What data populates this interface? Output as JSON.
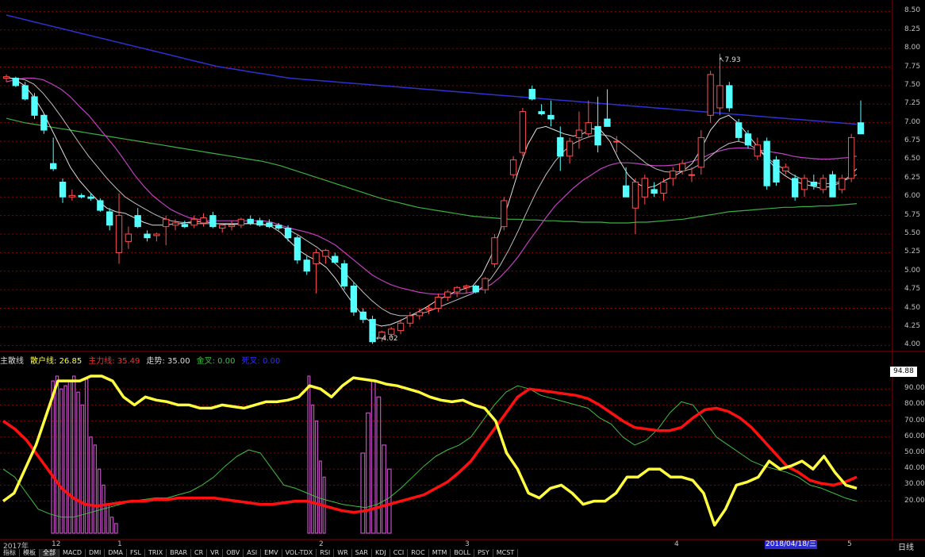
{
  "colors": {
    "grid": "#8b0000",
    "up_candle": "#ff5050",
    "down_candle": "#54ffff",
    "ma_white": "#e0e0e0",
    "ma_purple": "#c040c0",
    "ma_green": "#3cb043",
    "ma_blue": "#3030d0",
    "yellow": "#ffff40",
    "red": "#ff1010",
    "green_thin": "#40c040",
    "bars": "#c050c0"
  },
  "price_axis": {
    "ticks": [
      "8.50",
      "8.25",
      "8.00",
      "7.75",
      "7.50",
      "7.25",
      "7.00",
      "6.75",
      "6.50",
      "6.25",
      "6.00",
      "5.75",
      "5.50",
      "5.25",
      "5.00",
      "4.75",
      "4.50",
      "4.25",
      "4.00"
    ]
  },
  "annotations": {
    "high": "7.93",
    "low": "4.02"
  },
  "indicator": {
    "name": "主散线",
    "retail_label": "散户线:",
    "retail_value": "26.85",
    "main_label": "主力线:",
    "main_value": "35.49",
    "trend_label": "走势:",
    "trend_value": "35.00",
    "gold_label": "金叉:",
    "gold_value": "0.00",
    "dead_label": "死叉:",
    "dead_value": "0.00",
    "current_badge": "94.88",
    "axis_ticks": [
      "90.00",
      "80.00",
      "70.00",
      "60.00",
      "50.00",
      "40.00",
      "30.00",
      "20.00"
    ]
  },
  "x_axis": {
    "year_label": "2017年",
    "months": [
      "12",
      "1",
      "2",
      "3",
      "4",
      "5"
    ],
    "date_badge": "2018/04/18/三",
    "period": "日线"
  },
  "tabs": [
    "指标",
    "模板",
    "全部",
    "MACD",
    "DMI",
    "DMA",
    "FSL",
    "TRIX",
    "BRAR",
    "CR",
    "VR",
    "OBV",
    "ASI",
    "EMV",
    "VOL-TDX",
    "RSI",
    "WR",
    "SAR",
    "KDJ",
    "CCI",
    "ROC",
    "MTM",
    "BOLL",
    "PSY",
    "MCST"
  ],
  "active_tab": "全部",
  "chart_data": {
    "type": "candlestick",
    "ylim": [
      3.95,
      8.6
    ],
    "candles": [
      {
        "o": 7.6,
        "h": 7.65,
        "l": 7.55,
        "c": 7.62
      },
      {
        "o": 7.6,
        "h": 7.62,
        "l": 7.48,
        "c": 7.5
      },
      {
        "o": 7.5,
        "h": 7.55,
        "l": 7.3,
        "c": 7.32
      },
      {
        "o": 7.35,
        "h": 7.4,
        "l": 7.05,
        "c": 7.1
      },
      {
        "o": 7.1,
        "h": 7.12,
        "l": 6.85,
        "c": 6.9
      },
      {
        "o": 6.45,
        "h": 6.8,
        "l": 6.35,
        "c": 6.38
      },
      {
        "o": 6.2,
        "h": 6.25,
        "l": 5.92,
        "c": 6.0
      },
      {
        "o": 6.0,
        "h": 6.1,
        "l": 5.95,
        "c": 6.02
      },
      {
        "o": 6.02,
        "h": 6.05,
        "l": 5.98,
        "c": 6.0
      },
      {
        "o": 6.0,
        "h": 6.05,
        "l": 5.95,
        "c": 5.98
      },
      {
        "o": 5.95,
        "h": 5.98,
        "l": 5.8,
        "c": 5.82
      },
      {
        "o": 5.8,
        "h": 5.85,
        "l": 5.55,
        "c": 5.62
      },
      {
        "o": 5.25,
        "h": 6.05,
        "l": 5.1,
        "c": 5.75
      },
      {
        "o": 5.4,
        "h": 5.6,
        "l": 5.3,
        "c": 5.5
      },
      {
        "o": 5.75,
        "h": 5.85,
        "l": 5.58,
        "c": 5.6
      },
      {
        "o": 5.5,
        "h": 5.55,
        "l": 5.4,
        "c": 5.45
      },
      {
        "o": 5.48,
        "h": 5.52,
        "l": 5.4,
        "c": 5.5
      },
      {
        "o": 5.6,
        "h": 5.75,
        "l": 5.35,
        "c": 5.7
      },
      {
        "o": 5.62,
        "h": 5.7,
        "l": 5.55,
        "c": 5.65
      },
      {
        "o": 5.63,
        "h": 5.68,
        "l": 5.58,
        "c": 5.6
      },
      {
        "o": 5.62,
        "h": 5.75,
        "l": 5.58,
        "c": 5.7
      },
      {
        "o": 5.65,
        "h": 5.78,
        "l": 5.6,
        "c": 5.72
      },
      {
        "o": 5.75,
        "h": 5.8,
        "l": 5.58,
        "c": 5.6
      },
      {
        "o": 5.58,
        "h": 5.65,
        "l": 5.52,
        "c": 5.62
      },
      {
        "o": 5.6,
        "h": 5.68,
        "l": 5.55,
        "c": 5.62
      },
      {
        "o": 5.62,
        "h": 5.72,
        "l": 5.58,
        "c": 5.7
      },
      {
        "o": 5.7,
        "h": 5.75,
        "l": 5.62,
        "c": 5.65
      },
      {
        "o": 5.68,
        "h": 5.72,
        "l": 5.6,
        "c": 5.62
      },
      {
        "o": 5.65,
        "h": 5.7,
        "l": 5.58,
        "c": 5.6
      },
      {
        "o": 5.62,
        "h": 5.65,
        "l": 5.55,
        "c": 5.58
      },
      {
        "o": 5.58,
        "h": 5.62,
        "l": 5.4,
        "c": 5.45
      },
      {
        "o": 5.45,
        "h": 5.48,
        "l": 5.1,
        "c": 5.15
      },
      {
        "o": 5.15,
        "h": 5.2,
        "l": 4.95,
        "c": 5.0
      },
      {
        "o": 5.1,
        "h": 5.3,
        "l": 4.7,
        "c": 5.25
      },
      {
        "o": 5.2,
        "h": 5.3,
        "l": 5.1,
        "c": 5.28
      },
      {
        "o": 5.2,
        "h": 5.25,
        "l": 5.1,
        "c": 5.12
      },
      {
        "o": 5.1,
        "h": 5.15,
        "l": 4.75,
        "c": 4.8
      },
      {
        "o": 4.8,
        "h": 4.85,
        "l": 4.4,
        "c": 4.45
      },
      {
        "o": 4.45,
        "h": 4.5,
        "l": 4.3,
        "c": 4.35
      },
      {
        "o": 4.35,
        "h": 4.4,
        "l": 4.02,
        "c": 4.05
      },
      {
        "o": 4.1,
        "h": 4.2,
        "l": 4.05,
        "c": 4.18
      },
      {
        "o": 4.15,
        "h": 4.25,
        "l": 4.1,
        "c": 4.22
      },
      {
        "o": 4.2,
        "h": 4.35,
        "l": 4.15,
        "c": 4.3
      },
      {
        "o": 4.3,
        "h": 4.45,
        "l": 4.25,
        "c": 4.4
      },
      {
        "o": 4.4,
        "h": 4.5,
        "l": 4.35,
        "c": 4.45
      },
      {
        "o": 4.48,
        "h": 4.55,
        "l": 4.42,
        "c": 4.5
      },
      {
        "o": 4.5,
        "h": 4.7,
        "l": 4.45,
        "c": 4.65
      },
      {
        "o": 4.65,
        "h": 4.75,
        "l": 4.6,
        "c": 4.72
      },
      {
        "o": 4.72,
        "h": 4.8,
        "l": 4.65,
        "c": 4.78
      },
      {
        "o": 4.78,
        "h": 4.82,
        "l": 4.7,
        "c": 4.8
      },
      {
        "o": 4.8,
        "h": 4.82,
        "l": 4.7,
        "c": 4.72
      },
      {
        "o": 4.75,
        "h": 4.92,
        "l": 4.7,
        "c": 4.9
      },
      {
        "o": 5.1,
        "h": 5.5,
        "l": 5.05,
        "c": 5.45
      },
      {
        "o": 5.6,
        "h": 6.0,
        "l": 5.55,
        "c": 5.95
      },
      {
        "o": 6.3,
        "h": 6.55,
        "l": 6.25,
        "c": 6.5
      },
      {
        "o": 6.6,
        "h": 7.2,
        "l": 6.55,
        "c": 7.15
      },
      {
        "o": 7.45,
        "h": 7.5,
        "l": 7.3,
        "c": 7.32
      },
      {
        "o": 7.15,
        "h": 7.25,
        "l": 7.1,
        "c": 7.12
      },
      {
        "o": 7.1,
        "h": 7.3,
        "l": 6.95,
        "c": 7.05
      },
      {
        "o": 6.8,
        "h": 6.95,
        "l": 6.35,
        "c": 6.55
      },
      {
        "o": 6.55,
        "h": 6.8,
        "l": 6.45,
        "c": 6.75
      },
      {
        "o": 6.8,
        "h": 7.15,
        "l": 6.65,
        "c": 6.9
      },
      {
        "o": 6.85,
        "h": 7.3,
        "l": 6.8,
        "c": 7.0
      },
      {
        "o": 6.95,
        "h": 7.35,
        "l": 6.6,
        "c": 6.7
      },
      {
        "o": 7.05,
        "h": 7.45,
        "l": 6.95,
        "c": 6.95
      },
      {
        "o": 6.75,
        "h": 6.82,
        "l": 6.6,
        "c": 6.75
      },
      {
        "o": 6.15,
        "h": 6.4,
        "l": 6.0,
        "c": 6.0
      },
      {
        "o": 5.85,
        "h": 6.25,
        "l": 5.5,
        "c": 6.2
      },
      {
        "o": 6.0,
        "h": 6.3,
        "l": 5.9,
        "c": 6.25
      },
      {
        "o": 6.1,
        "h": 6.2,
        "l": 6.0,
        "c": 6.05
      },
      {
        "o": 6.05,
        "h": 6.25,
        "l": 5.95,
        "c": 6.2
      },
      {
        "o": 6.25,
        "h": 6.4,
        "l": 6.15,
        "c": 6.35
      },
      {
        "o": 6.35,
        "h": 6.5,
        "l": 6.3,
        "c": 6.45
      },
      {
        "o": 6.3,
        "h": 6.4,
        "l": 6.2,
        "c": 6.3
      },
      {
        "o": 6.4,
        "h": 6.9,
        "l": 6.3,
        "c": 6.8
      },
      {
        "o": 7.1,
        "h": 7.7,
        "l": 7.0,
        "c": 7.65
      },
      {
        "o": 7.2,
        "h": 7.93,
        "l": 7.1,
        "c": 7.5
      },
      {
        "o": 7.5,
        "h": 7.55,
        "l": 7.15,
        "c": 7.2
      },
      {
        "o": 7.0,
        "h": 7.05,
        "l": 6.75,
        "c": 6.8
      },
      {
        "o": 6.85,
        "h": 6.9,
        "l": 6.65,
        "c": 6.7
      },
      {
        "o": 6.55,
        "h": 6.8,
        "l": 6.5,
        "c": 6.7
      },
      {
        "o": 6.75,
        "h": 6.8,
        "l": 6.1,
        "c": 6.15
      },
      {
        "o": 6.5,
        "h": 6.55,
        "l": 6.15,
        "c": 6.2
      },
      {
        "o": 6.35,
        "h": 6.45,
        "l": 6.3,
        "c": 6.4
      },
      {
        "o": 6.25,
        "h": 6.3,
        "l": 5.95,
        "c": 6.0
      },
      {
        "o": 6.1,
        "h": 6.3,
        "l": 6.0,
        "c": 6.25
      },
      {
        "o": 6.2,
        "h": 6.3,
        "l": 6.1,
        "c": 6.15
      },
      {
        "o": 6.1,
        "h": 6.3,
        "l": 6.05,
        "c": 6.25
      },
      {
        "o": 6.3,
        "h": 6.35,
        "l": 6.0,
        "c": 6.0
      },
      {
        "o": 6.1,
        "h": 6.3,
        "l": 6.05,
        "c": 6.25
      },
      {
        "o": 6.25,
        "h": 6.85,
        "l": 6.2,
        "c": 6.8
      },
      {
        "o": 7.0,
        "h": 7.3,
        "l": 6.85,
        "c": 6.85
      }
    ],
    "ma_white_short": [
      7.62,
      7.58,
      7.5,
      7.35,
      7.15,
      6.9,
      6.65,
      6.4,
      6.22,
      6.08,
      5.95,
      5.85,
      5.8,
      5.78,
      5.72,
      5.66,
      5.62,
      5.62,
      5.63,
      5.64,
      5.66,
      5.67,
      5.66,
      5.64,
      5.63,
      5.63,
      5.64,
      5.64,
      5.63,
      5.6,
      5.52,
      5.4,
      5.28,
      5.2,
      5.14,
      5.05,
      4.9,
      4.72,
      4.55,
      4.4,
      4.3,
      4.26,
      4.28,
      4.33,
      4.39,
      4.45,
      4.52,
      4.6,
      4.66,
      4.72,
      4.76,
      4.8,
      4.95,
      5.2,
      5.55,
      5.95,
      6.35,
      6.7,
      6.92,
      6.95,
      6.9,
      6.85,
      6.82,
      6.85,
      6.92,
      6.9,
      6.75,
      6.5,
      6.3,
      6.18,
      6.12,
      6.15,
      6.22,
      6.28,
      6.35,
      6.45,
      6.65,
      6.9,
      7.05,
      7.1,
      7.0,
      6.85,
      6.7,
      6.55,
      6.4,
      6.3,
      6.22,
      6.18,
      6.15,
      6.12,
      6.14,
      6.18,
      6.26,
      6.38
    ],
    "ma_white_mid": [
      7.6,
      7.6,
      7.58,
      7.52,
      7.4,
      7.25,
      7.08,
      6.9,
      6.72,
      6.55,
      6.4,
      6.25,
      6.12,
      6.0,
      5.92,
      5.85,
      5.78,
      5.72,
      5.68,
      5.66,
      5.65,
      5.64,
      5.64,
      5.64,
      5.64,
      5.64,
      5.64,
      5.64,
      5.63,
      5.62,
      5.6,
      5.55,
      5.48,
      5.4,
      5.32,
      5.22,
      5.1,
      4.98,
      4.85,
      4.72,
      4.6,
      4.5,
      4.43,
      4.4,
      4.4,
      4.42,
      4.45,
      4.5,
      4.55,
      4.6,
      4.65,
      4.7,
      4.78,
      4.9,
      5.08,
      5.3,
      5.55,
      5.82,
      6.08,
      6.3,
      6.48,
      6.62,
      6.72,
      6.78,
      6.82,
      6.84,
      6.82,
      6.75,
      6.65,
      6.55,
      6.45,
      6.38,
      6.34,
      6.33,
      6.35,
      6.38,
      6.45,
      6.55,
      6.65,
      6.72,
      6.75,
      6.72,
      6.65,
      6.55,
      6.45,
      6.38,
      6.3,
      6.24,
      6.2,
      6.18,
      6.18,
      6.2,
      6.24,
      6.3
    ],
    "ma_purple": [
      7.55,
      7.58,
      7.6,
      7.6,
      7.58,
      7.52,
      7.45,
      7.35,
      7.22,
      7.1,
      6.95,
      6.8,
      6.65,
      6.48,
      6.3,
      6.15,
      6.02,
      5.92,
      5.83,
      5.77,
      5.72,
      5.7,
      5.68,
      5.68,
      5.68,
      5.68,
      5.68,
      5.68,
      5.68,
      5.66,
      5.62,
      5.58,
      5.55,
      5.52,
      5.48,
      5.42,
      5.35,
      5.25,
      5.15,
      5.05,
      4.95,
      4.88,
      4.82,
      4.78,
      4.75,
      4.72,
      4.7,
      4.69,
      4.69,
      4.7,
      4.7,
      4.72,
      4.76,
      4.82,
      4.92,
      5.05,
      5.2,
      5.38,
      5.55,
      5.72,
      5.88,
      6.0,
      6.12,
      6.22,
      6.3,
      6.38,
      6.43,
      6.46,
      6.46,
      6.45,
      6.43,
      6.42,
      6.42,
      6.43,
      6.45,
      6.48,
      6.52,
      6.58,
      6.62,
      6.65,
      6.66,
      6.66,
      6.64,
      6.62,
      6.6,
      6.58,
      6.55,
      6.53,
      6.52,
      6.51,
      6.51,
      6.52,
      6.53,
      6.55
    ],
    "ma_green": [
      7.06,
      7.03,
      7.0,
      6.98,
      6.96,
      6.94,
      6.92,
      6.9,
      6.88,
      6.86,
      6.84,
      6.82,
      6.8,
      6.78,
      6.76,
      6.74,
      6.72,
      6.7,
      6.68,
      6.66,
      6.64,
      6.62,
      6.6,
      6.58,
      6.56,
      6.54,
      6.52,
      6.5,
      6.48,
      6.45,
      6.42,
      6.38,
      6.34,
      6.3,
      6.26,
      6.22,
      6.18,
      6.14,
      6.1,
      6.06,
      6.02,
      5.98,
      5.95,
      5.92,
      5.89,
      5.86,
      5.84,
      5.82,
      5.8,
      5.78,
      5.76,
      5.74,
      5.73,
      5.72,
      5.71,
      5.7,
      5.7,
      5.69,
      5.69,
      5.68,
      5.68,
      5.67,
      5.67,
      5.66,
      5.66,
      5.66,
      5.65,
      5.65,
      5.65,
      5.66,
      5.66,
      5.67,
      5.68,
      5.69,
      5.7,
      5.72,
      5.74,
      5.76,
      5.78,
      5.8,
      5.81,
      5.82,
      5.83,
      5.84,
      5.85,
      5.86,
      5.86,
      5.87,
      5.87,
      5.88,
      5.88,
      5.89,
      5.9,
      5.91
    ],
    "ma_blue": [
      8.45,
      8.42,
      8.39,
      8.36,
      8.33,
      8.3,
      8.27,
      8.24,
      8.21,
      8.18,
      8.15,
      8.12,
      8.09,
      8.06,
      8.03,
      8.0,
      7.97,
      7.94,
      7.91,
      7.88,
      7.85,
      7.82,
      7.79,
      7.76,
      7.74,
      7.72,
      7.7,
      7.68,
      7.66,
      7.64,
      7.62,
      7.6,
      7.59,
      7.58,
      7.57,
      7.56,
      7.55,
      7.54,
      7.53,
      7.52,
      7.51,
      7.5,
      7.49,
      7.48,
      7.47,
      7.46,
      7.45,
      7.44,
      7.43,
      7.42,
      7.41,
      7.4,
      7.39,
      7.38,
      7.37,
      7.36,
      7.35,
      7.34,
      7.33,
      7.32,
      7.31,
      7.3,
      7.29,
      7.28,
      7.27,
      7.26,
      7.25,
      7.24,
      7.23,
      7.22,
      7.21,
      7.2,
      7.19,
      7.18,
      7.17,
      7.16,
      7.15,
      7.14,
      7.13,
      7.12,
      7.11,
      7.1,
      7.09,
      7.08,
      7.07,
      7.06,
      7.05,
      7.04,
      7.03,
      7.02,
      7.01,
      7.0,
      6.99,
      6.98
    ],
    "indicator_ylim": [
      0,
      100
    ],
    "yellow_line": [
      20,
      25,
      40,
      55,
      75,
      95,
      95,
      95,
      98,
      98,
      95,
      85,
      80,
      85,
      83,
      82,
      80,
      80,
      78,
      78,
      80,
      79,
      78,
      80,
      82,
      82,
      83,
      85,
      92,
      90,
      85,
      92,
      97,
      96,
      95,
      93,
      92,
      90,
      88,
      85,
      83,
      82,
      83,
      80,
      78,
      70,
      50,
      40,
      25,
      22,
      28,
      30,
      25,
      18,
      20,
      20,
      25,
      35,
      35,
      40,
      40,
      35,
      35,
      33,
      25,
      5,
      15,
      30,
      32,
      35,
      45,
      40,
      42,
      45,
      40,
      48,
      38,
      30,
      28
    ],
    "red_line": [
      70,
      65,
      58,
      48,
      38,
      28,
      22,
      18,
      17,
      18,
      19,
      20,
      20,
      21,
      21,
      22,
      22,
      22,
      22,
      21,
      20,
      19,
      18,
      18,
      19,
      20,
      20,
      18,
      16,
      14,
      13,
      14,
      16,
      18,
      20,
      22,
      24,
      28,
      32,
      38,
      45,
      55,
      65,
      75,
      85,
      90,
      89,
      88,
      87,
      86,
      84,
      80,
      75,
      70,
      66,
      65,
      64,
      64,
      66,
      72,
      77,
      78,
      76,
      72,
      66,
      58,
      50,
      42,
      38,
      33,
      31,
      30,
      32,
      35
    ],
    "green_thin_line": [
      40,
      35,
      25,
      15,
      12,
      10,
      10,
      12,
      14,
      16,
      18,
      20,
      21,
      22,
      22,
      24,
      26,
      30,
      35,
      42,
      48,
      52,
      50,
      40,
      30,
      28,
      25,
      22,
      20,
      18,
      17,
      16,
      18,
      22,
      28,
      35,
      42,
      48,
      52,
      55,
      60,
      70,
      80,
      88,
      92,
      90,
      86,
      84,
      82,
      80,
      78,
      72,
      68,
      60,
      55,
      58,
      65,
      75,
      82,
      80,
      70,
      60,
      55,
      50,
      45,
      42,
      40,
      38,
      35,
      30,
      28,
      25,
      22,
      20
    ]
  }
}
